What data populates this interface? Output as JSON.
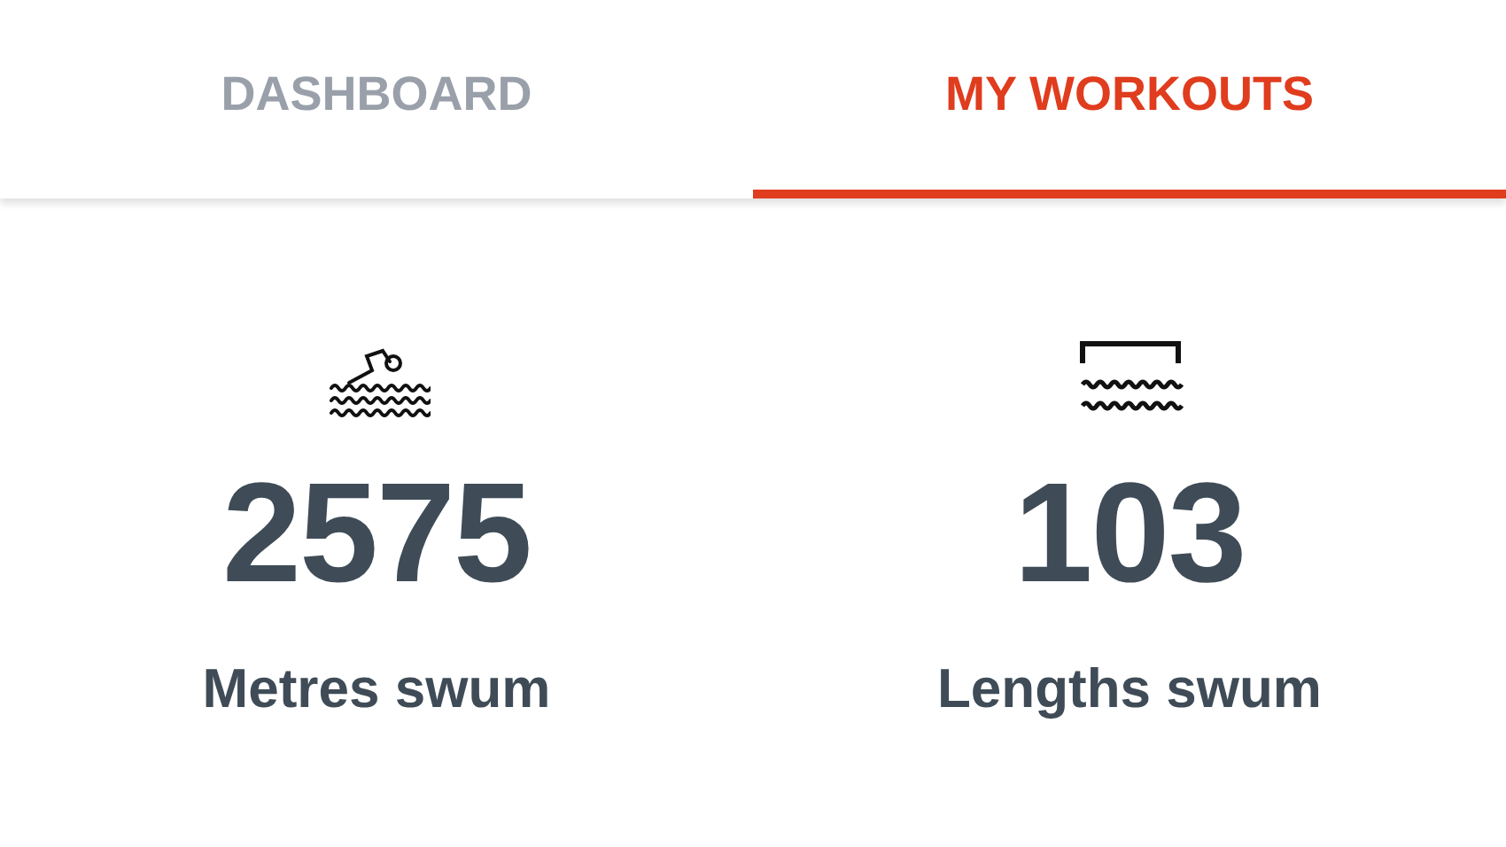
{
  "tabs": [
    {
      "label": "DASHBOARD",
      "selected": false
    },
    {
      "label": "MY WORKOUTS",
      "selected": true
    }
  ],
  "stats": [
    {
      "kind": "swimmer",
      "value": "2575",
      "label": "Metres swum"
    },
    {
      "kind": "pool",
      "value": "103",
      "label": "Lengths swum"
    }
  ]
}
